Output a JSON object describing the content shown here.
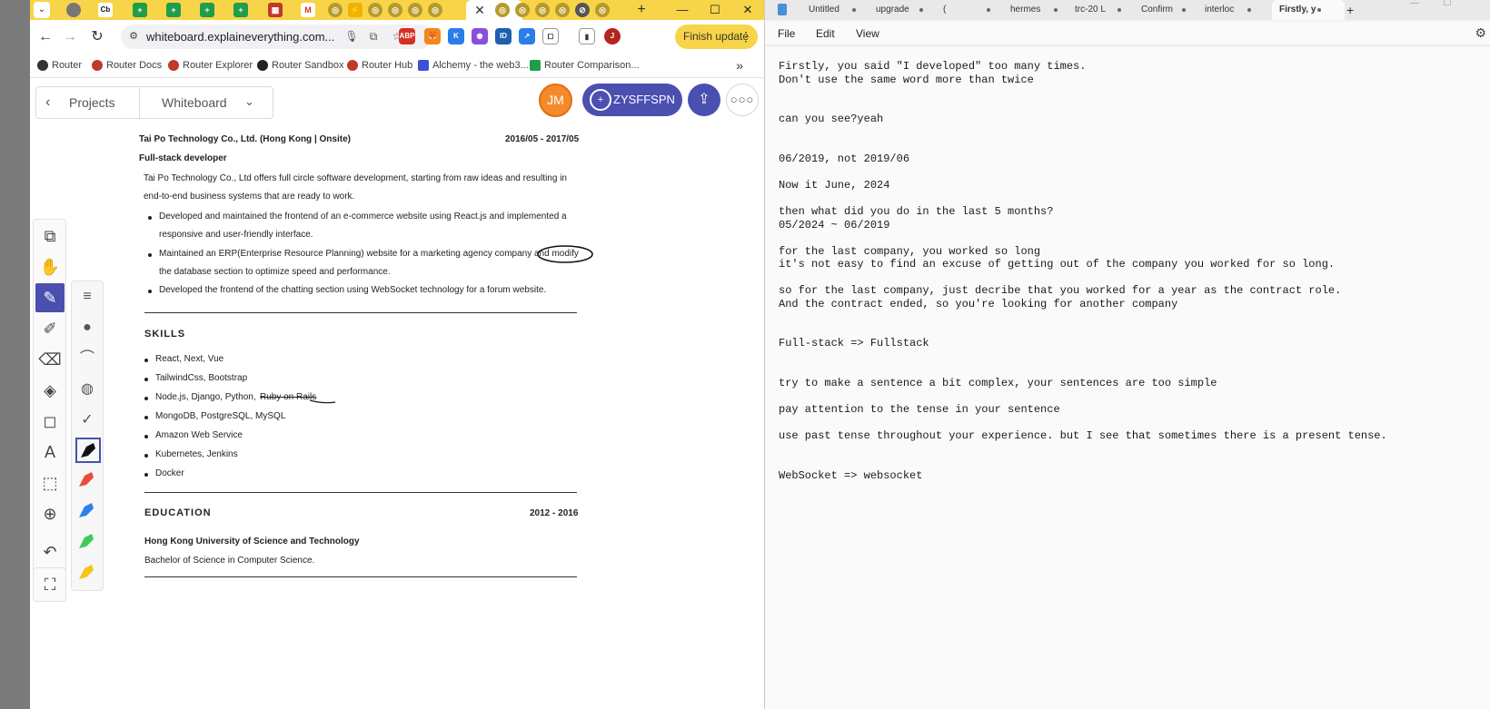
{
  "browser": {
    "tab_marks": [
      "Cb",
      "M"
    ],
    "active_tab_close": "✕",
    "url": "whiteboard.explaineverything.com...",
    "finish_update": "Finish update",
    "profile_initial": "J",
    "bookmarks": [
      "Router",
      "Router Docs",
      "Router Explorer",
      "Router Sandbox",
      "Router Hub",
      "Alchemy - the web3...",
      "Router Comparison..."
    ]
  },
  "app": {
    "back_label": "Projects",
    "whiteboard_label": "Whiteboard",
    "avatar_initials": "JM",
    "invite_code": "ZYSFFSPN"
  },
  "resume": {
    "company": "Tai Po Technology Co., Ltd.  (Hong Kong | Onsite)",
    "dates": "2016/05 - 2017/05",
    "role": "Full-stack developer",
    "summary_1": "Tai Po Technology Co., Ltd offers full circle software development, starting from raw ideas and resulting in",
    "summary_2": "end-to-end business systems that are ready to work.",
    "b1_1": "Developed and maintained the frontend of an e-commerce website using React.js and implemented a",
    "b1_2": "responsive and user-friendly interface.",
    "b2_1": "Maintained an ERP(Enterprise Resource Planning) website for a marketing agency company and modify",
    "b2_2": "the database section to optimize speed and performance.",
    "b3": "Developed the frontend of the chatting section using WebSocket technology for a forum website.",
    "skills_heading": "SKILLS",
    "skills": [
      "React, Next, Vue",
      "TailwindCss, Bootstrap",
      "Node.js, Django, Python,",
      "MongoDB, PostgreSQL, MySQL",
      "Amazon Web Service",
      "Kubernetes, Jenkins",
      "Docker"
    ],
    "skill_struck": "Ruby on Rails",
    "education_heading": "EDUCATION",
    "education_dates": "2012 - 2016",
    "school": "Hong Kong University of Science and Technology",
    "degree": "Bachelor of Science in Computer Science."
  },
  "notepad": {
    "tabs": [
      "Untitled",
      "upgrade",
      "(",
      "hermes",
      "trc-20 L",
      "Confirm",
      "interloc",
      "Firstly, y"
    ],
    "new_tab": "+",
    "menu": [
      "File",
      "Edit",
      "View"
    ],
    "lines": [
      "Firstly, you said \"I developed\" too many times.",
      "Don't use the same word more than twice",
      "can you see?yeah",
      "06/2019, not 2019/06",
      "Now it June, 2024",
      "then what did you do in the last 5 months?",
      "05/2024 ~ 06/2019",
      "for the last company, you worked so long",
      "it's not easy to find an excuse of getting out of the company you worked for so long.",
      "so for the last company, just decribe that you worked for a year as the contract role.",
      "And the contract ended, so you're looking for another company",
      "Full-stack => Fullstack",
      "try to make a sentence a bit complex, your sentences are too simple",
      "pay attention to the tense in your sentence",
      "use past tense throughout your experience. but I see that sometimes there is a present tense.",
      "WebSocket => websocket"
    ]
  }
}
